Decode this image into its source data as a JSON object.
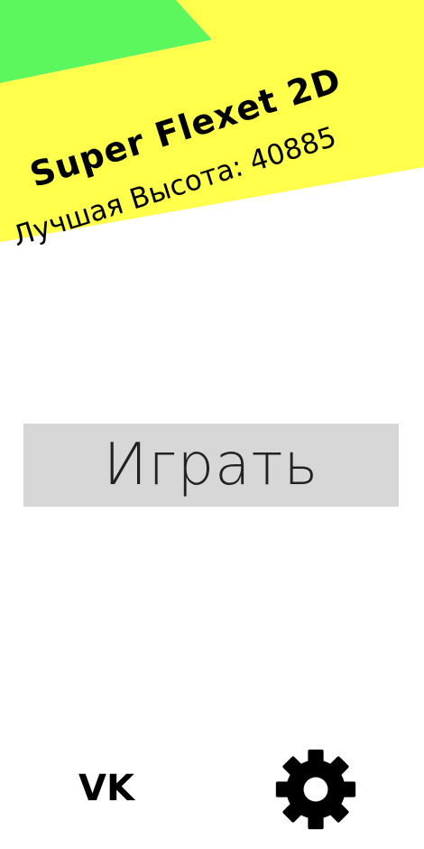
{
  "header": {
    "title": "Super Flexet 2D",
    "best_height": "Лучшая Высота: 40885"
  },
  "menu": {
    "play_label": "Играть"
  },
  "footer": {
    "vk_label": "VK",
    "settings_icon": "gear-icon"
  },
  "colors": {
    "banner_yellow": "#ffff4c",
    "banner_green": "#5cf75c",
    "button_gray": "#d7d7d7"
  }
}
